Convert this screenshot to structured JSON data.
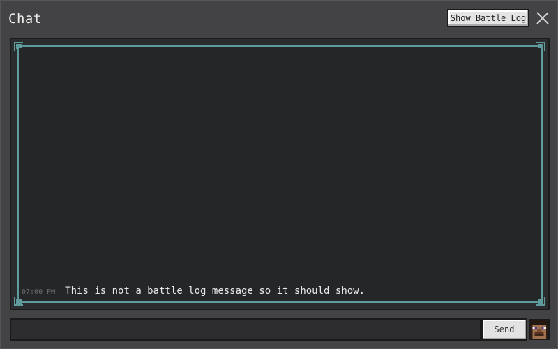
{
  "window": {
    "title": "Chat",
    "close_icon": "close-icon"
  },
  "toolbar": {
    "battle_log_label": "Show Battle Log"
  },
  "chat": {
    "messages": [
      {
        "time": "07:00 PM",
        "text": "This is not a battle log message so it should show."
      }
    ]
  },
  "composer": {
    "input_value": "",
    "input_placeholder": "",
    "send_label": "Send",
    "emote_icon": "player-head-icon"
  },
  "colors": {
    "panel_background": "#434345",
    "chat_background": "#252628",
    "frame_accent": "#5f9a9c",
    "button_face": "#e4e4e4"
  }
}
